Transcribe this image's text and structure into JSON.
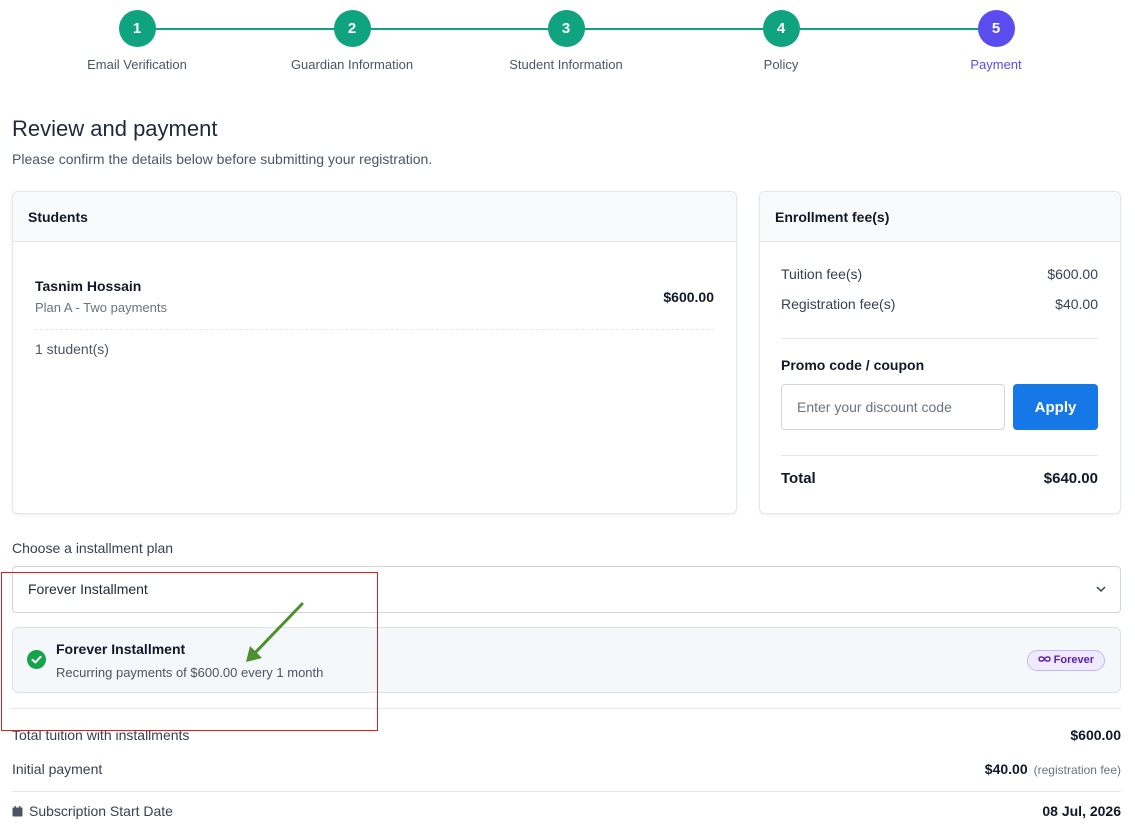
{
  "stepper": {
    "steps": [
      {
        "number": "1",
        "label": "Email Verification"
      },
      {
        "number": "2",
        "label": "Guardian Information"
      },
      {
        "number": "3",
        "label": "Student Information"
      },
      {
        "number": "4",
        "label": "Policy"
      },
      {
        "number": "5",
        "label": "Payment"
      }
    ],
    "completed_color": "#10a37f",
    "active_color": "#5b4cf0"
  },
  "header": {
    "title": "Review and payment",
    "subtitle": "Please confirm the details below before submitting your registration."
  },
  "students": {
    "title": "Students",
    "items": [
      {
        "name": "Tasnim Hossain",
        "plan": "Plan A - Two payments",
        "price": "$600.00"
      }
    ],
    "count_label": "1 student(s)"
  },
  "fees": {
    "title": "Enrollment fee(s)",
    "rows": [
      {
        "label": "Tuition fee(s)",
        "value": "$600.00"
      },
      {
        "label": "Registration fee(s)",
        "value": "$40.00"
      }
    ],
    "promo_label": "Promo code / coupon",
    "promo_placeholder": "Enter your discount code",
    "apply_label": "Apply",
    "total_label": "Total",
    "total_value": "$640.00"
  },
  "installment": {
    "label": "Choose a installment plan",
    "selected": "Forever Installment",
    "plan_title": "Forever Installment",
    "plan_description": "Recurring payments of $600.00 every 1 month",
    "badge": "Forever",
    "badge_icon": "infinity-icon"
  },
  "summary": {
    "total_tuition_label": "Total tuition with installments",
    "total_tuition_value": "$600.00",
    "initial_payment_label": "Initial payment",
    "initial_payment_value": "$40.00",
    "initial_payment_note": "(registration fee)",
    "start_date_label": "Subscription Start Date",
    "start_date_value": "08 Jul, 2026"
  },
  "annotation_colors": {
    "highlight_box": "#d81e1e",
    "arrow": "#4e8f2e"
  }
}
